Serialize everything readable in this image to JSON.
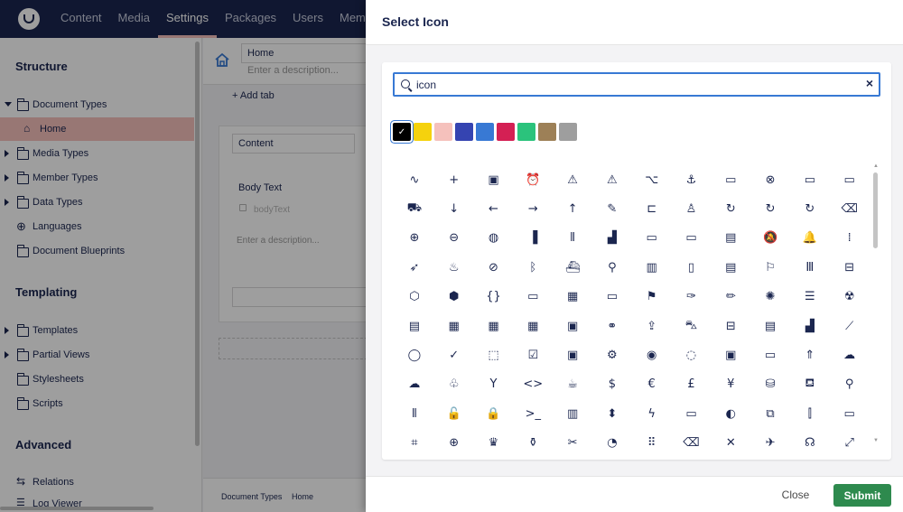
{
  "topbar": {
    "nav": [
      "Content",
      "Media",
      "Settings",
      "Packages",
      "Users",
      "Memb"
    ],
    "active": "Settings"
  },
  "sidebar": {
    "structure_title": "Structure",
    "structure_items": [
      {
        "label": "Document Types",
        "expanded": true
      },
      {
        "label": "Home",
        "selected": true
      },
      {
        "label": "Media Types"
      },
      {
        "label": "Member Types"
      },
      {
        "label": "Data Types"
      },
      {
        "label": "Languages"
      },
      {
        "label": "Document Blueprints"
      }
    ],
    "templating_title": "Templating",
    "templating_items": [
      {
        "label": "Templates"
      },
      {
        "label": "Partial Views"
      },
      {
        "label": "Stylesheets"
      },
      {
        "label": "Scripts"
      }
    ],
    "advanced_title": "Advanced",
    "advanced_items": [
      {
        "label": "Relations"
      },
      {
        "label": "Log Viewer"
      }
    ]
  },
  "editor": {
    "name_value": "Home",
    "description_placeholder": "Enter a description...",
    "add_tab": "Add tab",
    "group_name": "Content",
    "property_name": "Body Text",
    "property_alias": "bodyText",
    "property_description": "Enter a description...",
    "breadcrumb": [
      "Document Types",
      "Home"
    ]
  },
  "dialog": {
    "title": "Select Icon",
    "search_value": "icon",
    "colors": [
      "#000000",
      "#f5d20d",
      "#f5c1bc",
      "#3544b1",
      "#3879d4",
      "#d42054",
      "#2bc37c",
      "#9d8057",
      "#9e9e9e"
    ],
    "selected_color_index": 0,
    "icons": [
      {
        "name": "activity-icon",
        "glyph": "∿"
      },
      {
        "name": "add-icon",
        "glyph": "+"
      },
      {
        "name": "contact-icon",
        "glyph": "▣"
      },
      {
        "name": "alarm-clock-icon",
        "glyph": "⏰"
      },
      {
        "name": "alert-icon",
        "glyph": "⚠"
      },
      {
        "name": "alert-alt-icon",
        "glyph": "⚠"
      },
      {
        "name": "alt-key-icon",
        "glyph": "⌥"
      },
      {
        "name": "anchor-icon",
        "glyph": "⚓"
      },
      {
        "name": "app-icon",
        "glyph": "▭"
      },
      {
        "name": "application-error-icon",
        "glyph": "⊗"
      },
      {
        "name": "application-window-icon",
        "glyph": "▭"
      },
      {
        "name": "application-window-alt-icon",
        "glyph": "▭"
      },
      {
        "name": "arrival-icon",
        "glyph": "⛟"
      },
      {
        "name": "arrow-down-icon",
        "glyph": "↓"
      },
      {
        "name": "arrow-left-icon",
        "glyph": "←"
      },
      {
        "name": "arrow-right-icon",
        "glyph": "→"
      },
      {
        "name": "arrow-up-icon",
        "glyph": "↑"
      },
      {
        "name": "attachment-icon",
        "glyph": "✎"
      },
      {
        "name": "audio-lines-icon",
        "glyph": "⊏"
      },
      {
        "name": "award-icon",
        "glyph": "♙"
      },
      {
        "name": "axis-rotation-icon",
        "glyph": "↻"
      },
      {
        "name": "axis-rotation-2-icon",
        "glyph": "↻"
      },
      {
        "name": "axis-rotation-3-icon",
        "glyph": "↻"
      },
      {
        "name": "backspace-icon",
        "glyph": "⌫"
      },
      {
        "name": "badge-add-icon",
        "glyph": "⊕"
      },
      {
        "name": "badge-remove-icon",
        "glyph": "⊖"
      },
      {
        "name": "ball-icon",
        "glyph": "◍"
      },
      {
        "name": "bar-chart-icon",
        "glyph": "▐"
      },
      {
        "name": "barcode-icon",
        "glyph": "⦀"
      },
      {
        "name": "bars-icon",
        "glyph": "▟"
      },
      {
        "name": "battery-low-icon",
        "glyph": "▭"
      },
      {
        "name": "battery-full-icon",
        "glyph": "▭"
      },
      {
        "name": "bill-icon",
        "glyph": "▤"
      },
      {
        "name": "bell-off-icon",
        "glyph": "🔕"
      },
      {
        "name": "bell-icon",
        "glyph": "🔔"
      },
      {
        "name": "binarycode-icon",
        "glyph": "⁞"
      },
      {
        "name": "bird-icon",
        "glyph": "➶"
      },
      {
        "name": "birthday-cake-icon",
        "glyph": "♨"
      },
      {
        "name": "block-icon",
        "glyph": "⊘"
      },
      {
        "name": "bluetooth-icon",
        "glyph": "ᛒ"
      },
      {
        "name": "boat-shipping-icon",
        "glyph": "⛴"
      },
      {
        "name": "bones-icon",
        "glyph": "⚲"
      },
      {
        "name": "book-alt-icon",
        "glyph": "▥"
      },
      {
        "name": "book-icon",
        "glyph": "▯"
      },
      {
        "name": "book-alt-2-icon",
        "glyph": "▤"
      },
      {
        "name": "bookmark-icon",
        "glyph": "⚐"
      },
      {
        "name": "books-icon",
        "glyph": "Ⅲ"
      },
      {
        "name": "box-alt-icon",
        "glyph": "⊟"
      },
      {
        "name": "box-open-icon",
        "glyph": "⬡"
      },
      {
        "name": "box-icon",
        "glyph": "⬢"
      },
      {
        "name": "brackets-icon",
        "glyph": "{}"
      },
      {
        "name": "brick-icon",
        "glyph": "▭"
      },
      {
        "name": "briefcase-icon",
        "glyph": "▦"
      },
      {
        "name": "browser-window-icon",
        "glyph": "▭"
      },
      {
        "name": "brush-alt-icon",
        "glyph": "⚑"
      },
      {
        "name": "brush-icon",
        "glyph": "✑"
      },
      {
        "name": "brush-alt-2-icon",
        "glyph": "✏"
      },
      {
        "name": "bug-icon",
        "glyph": "✺"
      },
      {
        "name": "bulleted-list-icon",
        "glyph": "☰"
      },
      {
        "name": "burn-icon",
        "glyph": "☢"
      },
      {
        "name": "bus-icon",
        "glyph": "▤"
      },
      {
        "name": "calculator-icon",
        "glyph": "▦"
      },
      {
        "name": "calendar-icon",
        "glyph": "▦"
      },
      {
        "name": "calendar-alt-icon",
        "glyph": "▦"
      },
      {
        "name": "camcorder-icon",
        "glyph": "▣"
      },
      {
        "name": "candy-icon",
        "glyph": "⚭"
      },
      {
        "name": "caps-lock-icon",
        "glyph": "⇪"
      },
      {
        "name": "car-icon",
        "glyph": "⛍"
      },
      {
        "name": "cash-register-icon",
        "glyph": "⊟"
      },
      {
        "name": "certificate-icon",
        "glyph": "▤"
      },
      {
        "name": "chart-icon",
        "glyph": "▟"
      },
      {
        "name": "chart-curve-icon",
        "glyph": "⟋"
      },
      {
        "name": "chat-icon",
        "glyph": "◯"
      },
      {
        "name": "check-icon",
        "glyph": "✓"
      },
      {
        "name": "checkbox-dotted-icon",
        "glyph": "⬚"
      },
      {
        "name": "checkbox-icon",
        "glyph": "☑"
      },
      {
        "name": "chip-icon",
        "glyph": "▣"
      },
      {
        "name": "chip-alt-icon",
        "glyph": "⚙"
      },
      {
        "name": "circle-dotted-active-icon",
        "glyph": "◉"
      },
      {
        "name": "circle-dotted-icon",
        "glyph": "◌"
      },
      {
        "name": "circuits-icon",
        "glyph": "▣"
      },
      {
        "name": "client-icon",
        "glyph": "▭"
      },
      {
        "name": "cloud-upload-icon",
        "glyph": "⇑"
      },
      {
        "name": "cloud-icon",
        "glyph": "☁"
      },
      {
        "name": "cloudy-icon",
        "glyph": "☁"
      },
      {
        "name": "clubs-icon",
        "glyph": "♧"
      },
      {
        "name": "cocktail-icon",
        "glyph": "Y"
      },
      {
        "name": "code-icon",
        "glyph": "<>"
      },
      {
        "name": "coffee-icon",
        "glyph": "☕"
      },
      {
        "name": "coin-dollar-icon",
        "glyph": "$"
      },
      {
        "name": "coin-euro-icon",
        "glyph": "€"
      },
      {
        "name": "coin-pound-icon",
        "glyph": "£"
      },
      {
        "name": "coin-yen-icon",
        "glyph": "¥"
      },
      {
        "name": "coins-icon",
        "glyph": "⛁"
      },
      {
        "name": "color-bucket-icon",
        "glyph": "⛾"
      },
      {
        "name": "colorpicker-icon",
        "glyph": "⚲"
      },
      {
        "name": "columns-icon",
        "glyph": "⦀"
      },
      {
        "name": "combination-lock-open-icon",
        "glyph": "🔓"
      },
      {
        "name": "combination-lock-icon",
        "glyph": "🔒"
      },
      {
        "name": "command-icon",
        "glyph": ">_"
      },
      {
        "name": "company-icon",
        "glyph": "▥"
      },
      {
        "name": "compress-icon",
        "glyph": "⬍"
      },
      {
        "name": "connection-icon",
        "glyph": "ϟ"
      },
      {
        "name": "console-icon",
        "glyph": "▭"
      },
      {
        "name": "contrast-icon",
        "glyph": "◐"
      },
      {
        "name": "conversation-icon",
        "glyph": "⧉"
      },
      {
        "name": "coverflow-icon",
        "glyph": "⫿"
      },
      {
        "name": "credit-card-icon",
        "glyph": "▭"
      },
      {
        "name": "crop-icon",
        "glyph": "⌗"
      },
      {
        "name": "crosshair-icon",
        "glyph": "⊕"
      },
      {
        "name": "crown-icon",
        "glyph": "♛"
      },
      {
        "name": "cupcake-icon",
        "glyph": "⚱"
      },
      {
        "name": "cut-icon",
        "glyph": "✂"
      },
      {
        "name": "dashboard-icon",
        "glyph": "◔"
      },
      {
        "name": "defrag-icon",
        "glyph": "⠿"
      },
      {
        "name": "delete-key-icon",
        "glyph": "⌫"
      },
      {
        "name": "delete-icon",
        "glyph": "✕"
      },
      {
        "name": "departure-icon",
        "glyph": "✈"
      },
      {
        "name": "diagnostics-icon",
        "glyph": "☊"
      },
      {
        "name": "diagonal-arrow-icon",
        "glyph": "⤢"
      }
    ],
    "close_label": "Close",
    "submit_label": "Submit"
  }
}
